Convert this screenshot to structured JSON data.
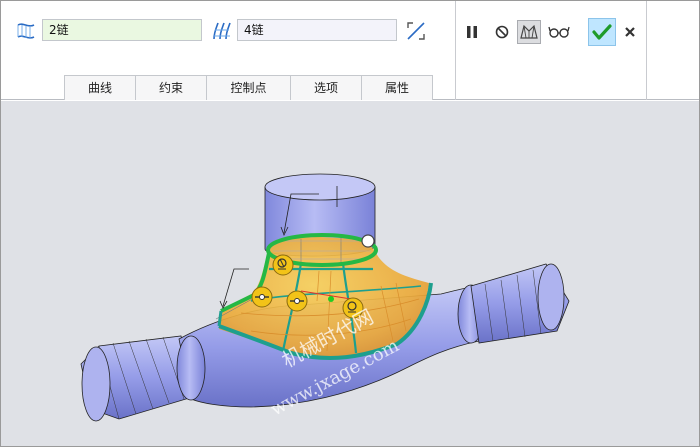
{
  "toolbar": {
    "first_chain": {
      "icon": "boundary-surface-icon",
      "value": "2链"
    },
    "second_chain": {
      "icon": "boundary-surface-icon",
      "value": "4链"
    },
    "swap_icon": "swap-direction-icon",
    "tabs": [
      {
        "label": "曲线"
      },
      {
        "label": "约束"
      },
      {
        "label": "控制点"
      },
      {
        "label": "选项"
      },
      {
        "label": "属性"
      }
    ],
    "controls": {
      "pause_icon": "pause-icon",
      "no_preview_icon": "no-preview-icon",
      "preview_icon": "geometry-preview-icon",
      "verify_icon": "glasses-icon",
      "ok_icon": "checkmark-icon",
      "cancel_icon": "close-icon"
    }
  },
  "viewport": {
    "background_color": "#dfe1e6",
    "body_color": "#9aa2ec",
    "surface_color": "#f0b43c",
    "chain_color": "#2eb84a",
    "watermark_cn": "机械时代网",
    "watermark_url": "www.jxage.com"
  }
}
